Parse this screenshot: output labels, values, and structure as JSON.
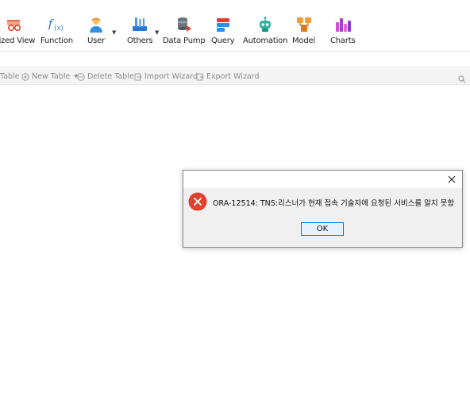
{
  "toolbar": {
    "items": [
      {
        "label": "lized View",
        "icon": "materialized-view-icon"
      },
      {
        "label": "Function",
        "icon": "function-icon"
      },
      {
        "label": "User",
        "icon": "user-icon"
      },
      {
        "label": "Others",
        "icon": "others-tools-icon"
      },
      {
        "label": "Data Pump",
        "icon": "data-pump-icon"
      },
      {
        "label": "Query",
        "icon": "query-icon"
      },
      {
        "label": "Automation",
        "icon": "automation-robot-icon"
      },
      {
        "label": "Model",
        "icon": "model-icon"
      },
      {
        "label": "Charts",
        "icon": "charts-icon"
      }
    ]
  },
  "object_toolbar": {
    "open_table": "Table",
    "new_table": "New Table",
    "delete_table": "Delete Table",
    "import_wizard": "Import Wizard",
    "export_wizard": "Export Wizard"
  },
  "dialog": {
    "message": "ORA-12514: TNS:리스너가 현재 접속 기술자에 요청된 서비스를 알지 못함",
    "ok_label": "OK"
  },
  "colors": {
    "error_red": "#e0412c",
    "accent_blue": "#0078d7",
    "function_blue": "#1d6fd1"
  }
}
